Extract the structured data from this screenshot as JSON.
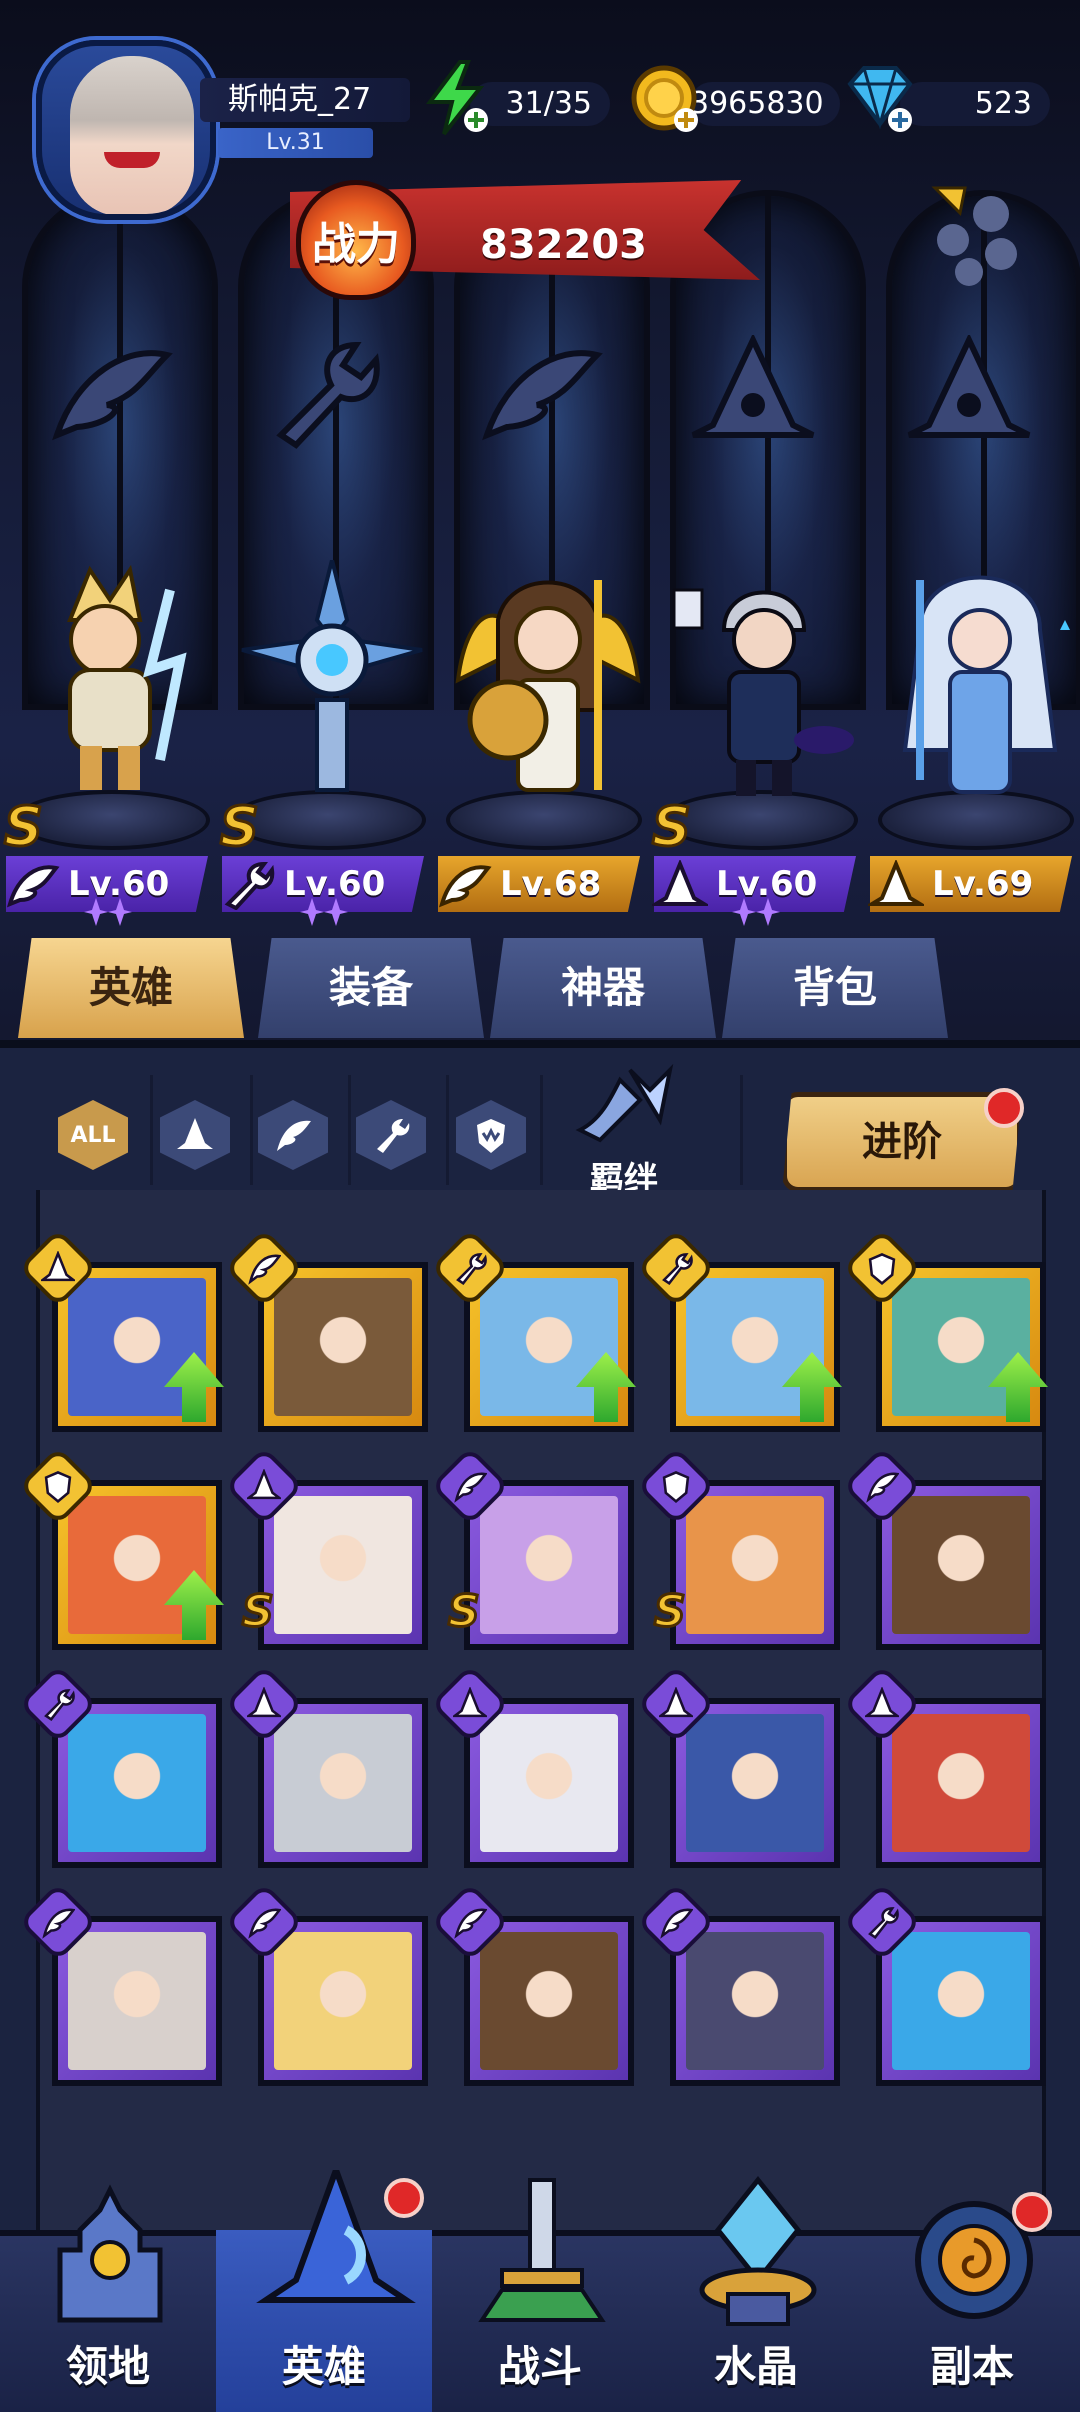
{
  "player": {
    "name": "斯帕克_27",
    "level": "Lv.31"
  },
  "resources": {
    "energy": "31/35",
    "gold": "3965830",
    "gems": "523"
  },
  "combat_power": {
    "badge": "战力",
    "value": "832203"
  },
  "lineup": [
    {
      "level": "Lv.60",
      "rank": "S",
      "tag_color": "purple",
      "class_icon": "wing-icon"
    },
    {
      "level": "Lv.60",
      "rank": "S",
      "tag_color": "purple",
      "class_icon": "wrench-icon"
    },
    {
      "level": "Lv.68",
      "rank": "",
      "tag_color": "gold",
      "class_icon": "wing-icon"
    },
    {
      "level": "Lv.60",
      "rank": "S",
      "tag_color": "purple",
      "class_icon": "wizard-hat-icon"
    },
    {
      "level": "Lv.69",
      "rank": "",
      "tag_color": "gold",
      "class_icon": "wizard-hat-icon"
    }
  ],
  "tabs": [
    {
      "label": "英雄",
      "active": true
    },
    {
      "label": "装备",
      "active": false
    },
    {
      "label": "神器",
      "active": false
    },
    {
      "label": "背包",
      "active": false
    }
  ],
  "filters": {
    "all": "ALL",
    "bond": "羁绊",
    "advance": "进阶"
  },
  "roster": [
    {
      "frame": "gold",
      "class": "wizard-hat",
      "upgrade": true,
      "rank": ""
    },
    {
      "frame": "gold",
      "class": "wing",
      "upgrade": false,
      "rank": ""
    },
    {
      "frame": "gold",
      "class": "wrench",
      "upgrade": true,
      "rank": ""
    },
    {
      "frame": "gold",
      "class": "wrench",
      "upgrade": true,
      "rank": ""
    },
    {
      "frame": "gold",
      "class": "shield",
      "upgrade": true,
      "rank": ""
    },
    {
      "frame": "gold",
      "class": "shield",
      "upgrade": true,
      "rank": ""
    },
    {
      "frame": "purple",
      "class": "wizard-hat",
      "upgrade": false,
      "rank": "S"
    },
    {
      "frame": "purple",
      "class": "wing",
      "upgrade": false,
      "rank": "S"
    },
    {
      "frame": "purple",
      "class": "shield",
      "upgrade": false,
      "rank": "S"
    },
    {
      "frame": "purple",
      "class": "wing",
      "upgrade": false,
      "rank": ""
    },
    {
      "frame": "purple",
      "class": "wrench",
      "upgrade": false,
      "rank": ""
    },
    {
      "frame": "purple",
      "class": "wizard-hat",
      "upgrade": false,
      "rank": ""
    },
    {
      "frame": "purple",
      "class": "wizard-hat",
      "upgrade": false,
      "rank": ""
    },
    {
      "frame": "purple",
      "class": "wizard-hat",
      "upgrade": false,
      "rank": ""
    },
    {
      "frame": "purple",
      "class": "wizard-hat",
      "upgrade": false,
      "rank": ""
    },
    {
      "frame": "purple",
      "class": "wing",
      "upgrade": false,
      "rank": ""
    },
    {
      "frame": "purple",
      "class": "wing",
      "upgrade": false,
      "rank": ""
    },
    {
      "frame": "purple",
      "class": "wing",
      "upgrade": false,
      "rank": ""
    },
    {
      "frame": "purple",
      "class": "wing",
      "upgrade": false,
      "rank": ""
    },
    {
      "frame": "purple",
      "class": "wrench",
      "upgrade": false,
      "rank": ""
    }
  ],
  "nav": [
    {
      "label": "领地",
      "active": false
    },
    {
      "label": "英雄",
      "active": true
    },
    {
      "label": "战斗",
      "active": false
    },
    {
      "label": "水晶",
      "active": false
    },
    {
      "label": "副本",
      "active": false
    }
  ],
  "colors": {
    "gold_frame": "#f6c32a",
    "purple_frame": "#8b5ae0",
    "power_banner": "#c8322e",
    "active_tab": "#f6d590"
  }
}
